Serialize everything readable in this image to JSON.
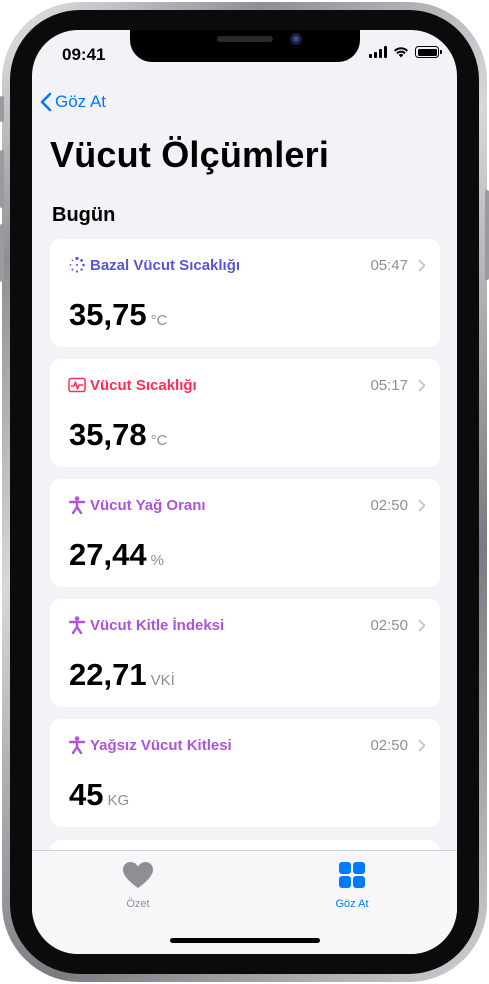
{
  "status_bar": {
    "time": "09:41"
  },
  "nav": {
    "back_label": "Göz At"
  },
  "page": {
    "title": "Vücut Ölçümleri"
  },
  "section": {
    "title": "Bugün"
  },
  "cards": [
    {
      "label": "Bazal Vücut Sıcaklığı",
      "time": "05:47",
      "value": "35,75",
      "unit": "°C",
      "color": "#5856d6",
      "icon": "dotted-circle-icon"
    },
    {
      "label": "Vücut Sıcaklığı",
      "time": "05:17",
      "value": "35,78",
      "unit": "°C",
      "color": "#ff2d55",
      "icon": "thermometer-waveform-icon"
    },
    {
      "label": "Vücut Yağ Oranı",
      "time": "02:50",
      "value": "27,44",
      "unit": "%",
      "color": "#af52de",
      "icon": "figure-icon"
    },
    {
      "label": "Vücut Kitle İndeksi",
      "time": "02:50",
      "value": "22,71",
      "unit": "VKİ",
      "color": "#af52de",
      "icon": "figure-icon"
    },
    {
      "label": "Yağsız Vücut Kitlesi",
      "time": "02:50",
      "value": "45",
      "unit": "KG",
      "color": "#af52de",
      "icon": "figure-icon"
    }
  ],
  "tab_bar": {
    "summary": {
      "label": "Özet",
      "icon": "heart-icon",
      "color": "#8e8e93"
    },
    "browse": {
      "label": "Göz At",
      "icon": "grid-icon",
      "color": "#007aff"
    }
  }
}
